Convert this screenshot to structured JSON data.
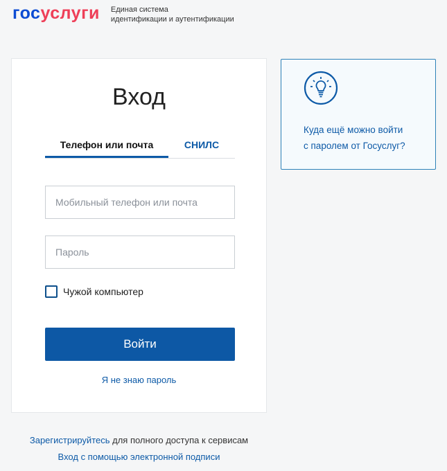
{
  "header": {
    "logo_part1": "гос",
    "logo_part2": "услуги",
    "system_line1": "Единая система",
    "system_line2": "идентификации и аутентификации"
  },
  "login": {
    "title": "Вход",
    "tabs": [
      {
        "label": "Телефон или почта",
        "active": true
      },
      {
        "label": "СНИЛС",
        "active": false
      }
    ],
    "phone_placeholder": "Мобильный телефон или почта",
    "password_placeholder": "Пароль",
    "checkbox_label": "Чужой компьютер",
    "submit_label": "Войти",
    "forgot_label": "Я не знаю пароль"
  },
  "info": {
    "icon": "lightbulb-icon",
    "line1": "Куда ещё можно войти",
    "line2": "с паролем от Госуслуг?"
  },
  "bottom": {
    "register_link": "Зарегистрируйтесь",
    "register_rest": " для полного доступа к сервисам",
    "signature_link": "Вход с помощью электронной подписи"
  },
  "colors": {
    "primary": "#0d58a5",
    "link": "#0d5aa7",
    "logo_blue": "#0d4cd3",
    "logo_red": "#ee3f58",
    "background": "#f5f6f7"
  }
}
